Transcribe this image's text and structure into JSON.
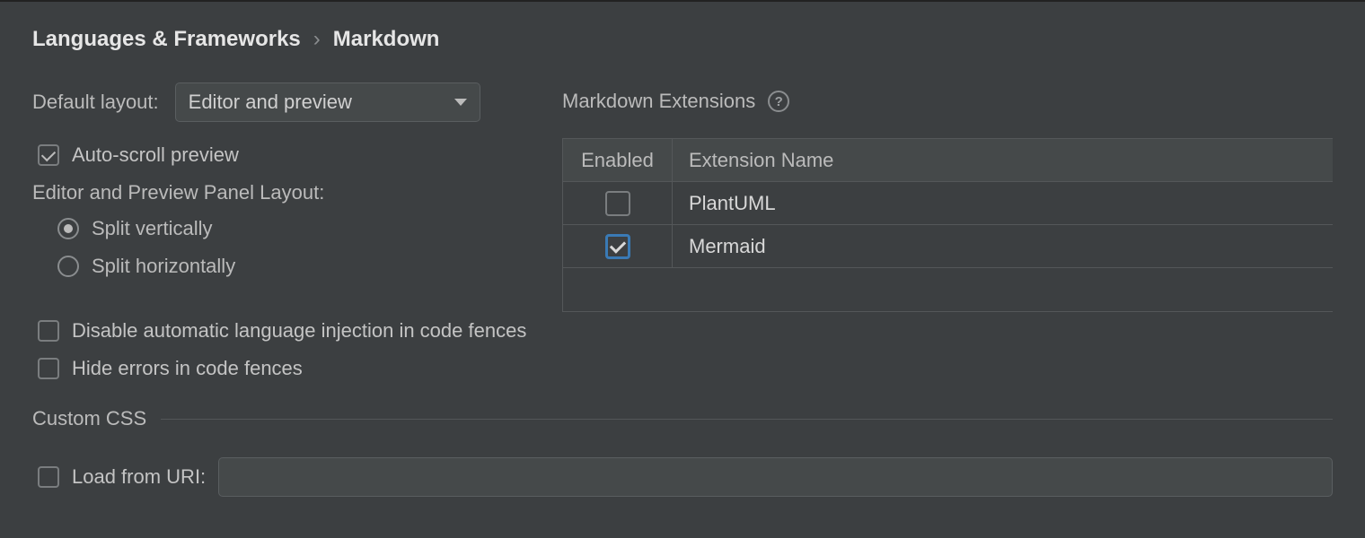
{
  "breadcrumb": {
    "parent": "Languages & Frameworks",
    "current": "Markdown"
  },
  "layout": {
    "default_layout_label": "Default layout:",
    "default_layout_value": "Editor and preview",
    "auto_scroll_label": "Auto-scroll preview",
    "auto_scroll_checked": true,
    "panel_layout_label": "Editor and Preview Panel Layout:",
    "split_vertically_label": "Split vertically",
    "split_horizontally_label": "Split horizontally",
    "split_selected": "vertical"
  },
  "options": {
    "disable_injection_label": "Disable automatic language injection in code fences",
    "disable_injection_checked": false,
    "hide_errors_label": "Hide errors in code fences",
    "hide_errors_checked": false
  },
  "extensions": {
    "header": "Markdown Extensions",
    "col_enabled": "Enabled",
    "col_name": "Extension Name",
    "rows": [
      {
        "name": "PlantUML",
        "enabled": false
      },
      {
        "name": "Mermaid",
        "enabled": true
      }
    ]
  },
  "custom_css": {
    "title": "Custom CSS",
    "load_uri_label": "Load from URI:",
    "load_uri_checked": false,
    "load_uri_value": ""
  }
}
